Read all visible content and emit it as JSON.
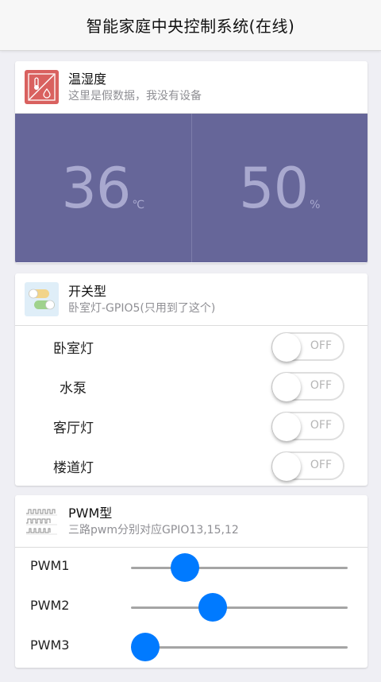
{
  "header": {
    "title": "智能家庭中央控制系统(在线)"
  },
  "sensor_card": {
    "title": "温湿度",
    "subtitle": "这里是假数据，我没有设备",
    "icon": "thermometer-droplet-icon",
    "accent": "#666699",
    "temperature": {
      "value": "36",
      "unit": "℃"
    },
    "humidity": {
      "value": "50",
      "unit": "%"
    }
  },
  "switch_card": {
    "title": "开关型",
    "subtitle": "卧室灯-GPIO5(只用到了这个)",
    "icon": "toggle-switch-icon",
    "items": [
      {
        "label": "卧室灯",
        "state": "OFF"
      },
      {
        "label": "水泵",
        "state": "OFF"
      },
      {
        "label": "客厅灯",
        "state": "OFF"
      },
      {
        "label": "楼道灯",
        "state": "OFF"
      }
    ]
  },
  "pwm_card": {
    "title": "PWM型",
    "subtitle": "三路pwm分别对应GPIO13,15,12",
    "icon": "waveform-icon",
    "accent": "#007aff",
    "sliders": [
      {
        "label": "PWM1",
        "level": 0.21
      },
      {
        "label": "PWM2",
        "level": 0.36
      },
      {
        "label": "PWM3",
        "level": 0.0
      }
    ]
  }
}
